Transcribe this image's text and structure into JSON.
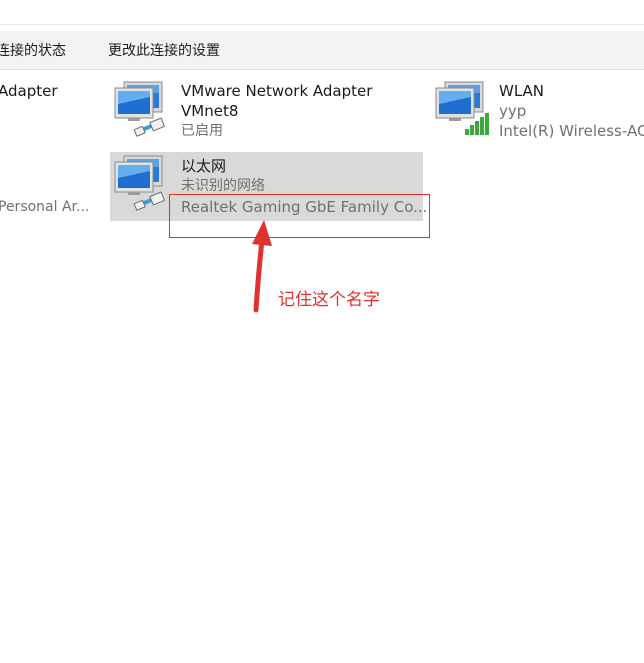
{
  "toolbar": {
    "status_label": "连接的状态",
    "settings_label": "更改此连接的设置"
  },
  "adapters": {
    "left_partial": {
      "name": "Adapter",
      "desc": "Personal Ar..."
    },
    "vmnet8": {
      "name_line1": "VMware Network Adapter",
      "name_line2": "VMnet8",
      "status": "已启用"
    },
    "ethernet": {
      "name": "以太网",
      "status": "未识别的网络",
      "device": "Realtek Gaming GbE Family Co..."
    },
    "wlan": {
      "name": "WLAN",
      "network": "yyp",
      "device": "Intel(R) Wireless-AC"
    }
  },
  "annotation": {
    "text": "记住这个名字",
    "color": "#e03131"
  },
  "colors": {
    "selection": "#d9d9d9",
    "toolbar_bg": "#f3f3f3",
    "signal_green": "#3aa935"
  }
}
